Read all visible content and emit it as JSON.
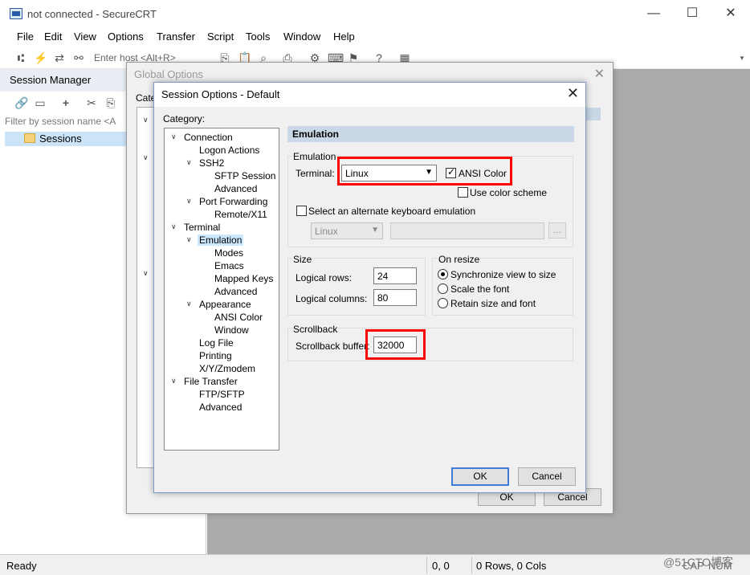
{
  "app": {
    "title": "not connected - SecureCRT",
    "controls": {
      "minimize": "—",
      "maximize": "☐",
      "close": "✕"
    }
  },
  "menu": [
    "File",
    "Edit",
    "View",
    "Options",
    "Transfer",
    "Script",
    "Tools",
    "Window",
    "Help"
  ],
  "toolbar": {
    "host_placeholder": "Enter host <Alt+R>"
  },
  "session_manager": {
    "title": "Session Manager",
    "filter_placeholder": "Filter by session name <A",
    "items": [
      "Sessions"
    ]
  },
  "global_options": {
    "title": "Global Options",
    "category_label": "Cate",
    "ok": "OK",
    "cancel": "Cancel"
  },
  "session_options": {
    "title": "Session Options - Default",
    "category_label": "Category:",
    "tree": [
      "Connection",
      "Logon Actions",
      "SSH2",
      "SFTP Session",
      "Advanced",
      "Port Forwarding",
      "Remote/X11",
      "Terminal",
      "Emulation",
      "Modes",
      "Emacs",
      "Mapped Keys",
      "Advanced",
      "Appearance",
      "ANSI Color",
      "Window",
      "Log File",
      "Printing",
      "X/Y/Zmodem",
      "File Transfer",
      "FTP/SFTP",
      "Advanced"
    ],
    "selected_node": "Emulation",
    "pane_title": "Emulation",
    "emulation": {
      "group": "Emulation",
      "terminal_label": "Terminal:",
      "terminal_value": "Linux",
      "ansi_color_label": "ANSI Color",
      "ansi_color_checked": true,
      "use_color_scheme_label": "Use color scheme",
      "use_color_scheme_checked": false,
      "alternate_label": "Select an alternate keyboard emulation",
      "alternate_checked": false,
      "alternate_value": "Linux",
      "browse_label": "..."
    },
    "size": {
      "group": "Size",
      "rows_label": "Logical rows:",
      "rows_value": "24",
      "cols_label": "Logical columns:",
      "cols_value": "80"
    },
    "on_resize": {
      "group": "On resize",
      "options": [
        "Synchronize view to size",
        "Scale the font",
        "Retain size and font"
      ],
      "selected": 0
    },
    "scrollback": {
      "group": "Scrollback",
      "buffer_label": "Scrollback buffer:",
      "buffer_value": "32000"
    },
    "ok": "OK",
    "cancel": "Cancel"
  },
  "statusbar": {
    "status": "Ready",
    "position": "0, 0",
    "size": "0 Rows, 0 Cols",
    "caps": "CAP",
    "num": "NUM"
  },
  "watermark": "@51CTO博客",
  "colors": {
    "highlight": "#ff0000",
    "selection": "#cce8ff",
    "header_band": "#c9d7e6"
  }
}
